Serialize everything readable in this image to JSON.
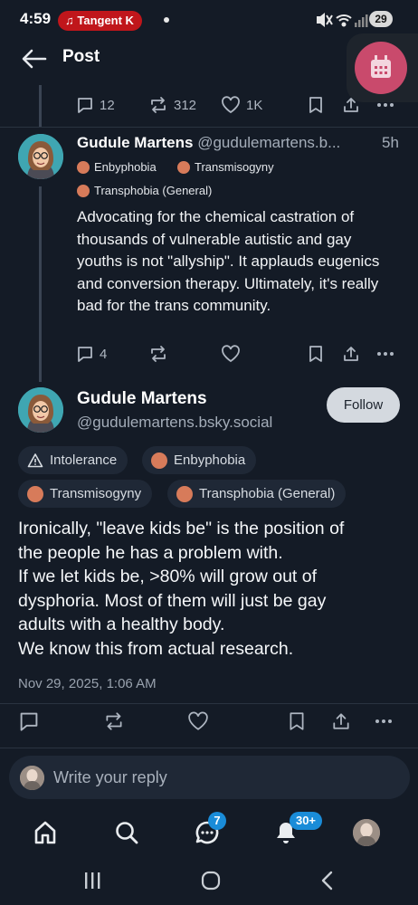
{
  "status_bar": {
    "time": "4:59",
    "notification_pill": "♫ Tangent K",
    "battery": "29"
  },
  "header": {
    "title": "Post"
  },
  "parent_actions": {
    "replies": "12",
    "reposts": "312",
    "likes": "1K"
  },
  "reply_post": {
    "author_name": "Gudule Martens",
    "author_handle": "@gudulemartens.b...",
    "time": "5h",
    "labels": [
      "Enbyphobia",
      "Transmisogyny",
      "Transphobia (General)"
    ],
    "text": "Advocating for the chemical castration of thousands of vulnerable autistic and gay youths is not \"allyship\". It applauds eugenics and conversion therapy. Ultimately, it's really bad for the trans community.",
    "replies": "4"
  },
  "main_post": {
    "author_name": "Gudule Martens",
    "author_handle": "@gudulemartens.bsky.social",
    "follow_label": "Follow",
    "labels": [
      "Intolerance",
      "Enbyphobia",
      "Transmisogyny",
      "Transphobia (General)"
    ],
    "text_lines": [
      "Ironically, \"leave kids be\" is the position of",
      "the people he has a problem with.",
      "If we let kids be, >80% will grow out of",
      "dysphoria. Most of them will just be gay",
      "adults with a healthy body.",
      "We know this from actual research."
    ],
    "date": "Nov 29, 2025, 1:06 AM"
  },
  "reply_input": {
    "placeholder": "Write your reply"
  },
  "tab_bar": {
    "chat_badge": "7",
    "notifications_badge": "30+"
  },
  "colors": {
    "background": "#141b26",
    "accent_blue": "#1a8cd8",
    "pill_bg": "#1f2836",
    "muted_text": "#a4adb9",
    "recording_pill": "#c0161b",
    "float_button": "#c94a6c"
  }
}
